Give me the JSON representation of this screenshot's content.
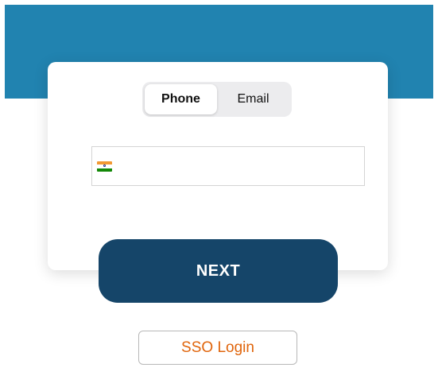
{
  "colors": {
    "header_band": "#2183b0",
    "primary_button": "#154569",
    "sso_text": "#e0650c"
  },
  "login_tabs": {
    "items": [
      "Phone",
      "Email"
    ],
    "selected": "Phone"
  },
  "phone_field": {
    "country_flag_icon": "india-flag-icon",
    "value": "",
    "placeholder": ""
  },
  "actions": {
    "next_label": "NEXT",
    "sso_label": "SSO Login"
  }
}
